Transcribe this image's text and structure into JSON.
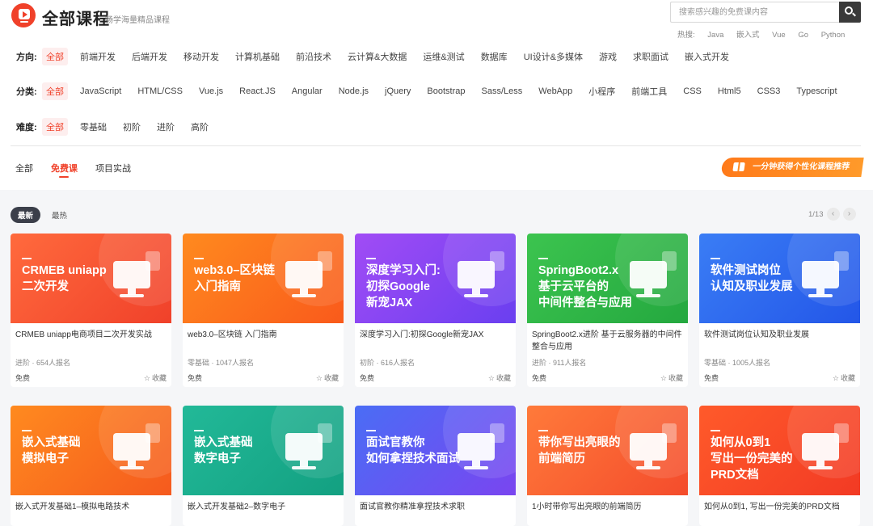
{
  "header": {
    "title": "全部课程",
    "subtitle": "畅学海量精品课程",
    "search_placeholder": "搜索感兴趣的免费课内容",
    "hot_label": "热搜:",
    "hot_words": [
      "Java",
      "嵌入式",
      "Vue",
      "Go",
      "Python"
    ]
  },
  "filters": {
    "direction": {
      "label": "方向:",
      "options": [
        "全部",
        "前端开发",
        "后端开发",
        "移动开发",
        "计算机基础",
        "前沿技术",
        "云计算&大数据",
        "运维&测试",
        "数据库",
        "UI设计&多媒体",
        "游戏",
        "求职面试",
        "嵌入式开发"
      ]
    },
    "category": {
      "label": "分类:",
      "options": [
        "全部",
        "JavaScript",
        "HTML/CSS",
        "Vue.js",
        "React.JS",
        "Angular",
        "Node.js",
        "jQuery",
        "Bootstrap",
        "Sass/Less",
        "WebApp",
        "小程序",
        "前端工具",
        "CSS",
        "Html5",
        "CSS3",
        "Typescript"
      ]
    },
    "difficulty": {
      "label": "难度:",
      "options": [
        "全部",
        "零基础",
        "初阶",
        "进阶",
        "高阶"
      ]
    }
  },
  "tabs": [
    "全部",
    "免费课",
    "项目实战"
  ],
  "promo_label": "一分钟获得个性化课程推荐",
  "sort": {
    "newest": "最新",
    "hottest": "最热"
  },
  "pager": {
    "text": "1/13",
    "prev": "‹",
    "next": "›"
  },
  "fav_label": "收藏",
  "colors": {
    "accent": "#f0412a",
    "orange_red": "#f4512c",
    "orange": "#f77a1c",
    "purple": "#8a3ff0",
    "green": "#2fb84b",
    "blue": "#2e6af0",
    "teal": "#17b08f"
  },
  "courses": [
    {
      "thumb_text": "CRMEB uniapp\n二次开发",
      "title": "CRMEB uniapp电商项目二次开发实战",
      "meta": "进阶 · 654人报名",
      "price": "免费",
      "icon": "puzzle-monitor-icon"
    },
    {
      "thumb_text": "web3.0–区块链\n入门指南",
      "title": "web3.0–区块链 入门指南",
      "meta": "零基础 · 1047人报名",
      "price": "免费",
      "icon": "blockchain-cubes-icon"
    },
    {
      "thumb_text": "深度学习入门:\n初探Google\n新宠JAX",
      "title": "深度学习入门:初探Google新宠JAX",
      "meta": "初阶 · 616人报名",
      "price": "免费",
      "icon": "jax-monitor-icon"
    },
    {
      "thumb_text": "SpringBoot2.x\n基于云平台的\n中间件整合与应用",
      "title": "SpringBoot2.x进阶 基于云服务器的中间件整合与应用",
      "meta": "进阶 · 911人报名",
      "price": "免费",
      "icon": "power-hexagon-icon"
    },
    {
      "thumb_text": "软件测试岗位\n认知及职业发展",
      "title": "软件测试岗位认知及职业发展",
      "meta": "零基础 · 1005人报名",
      "price": "免费",
      "icon": "gauge-monitor-icon"
    },
    {
      "thumb_text": "嵌入式基础\n模拟电子",
      "title": "嵌入式开发基础1–模拟电路技术",
      "icon": "server-chip-icon"
    },
    {
      "thumb_text": "嵌入式基础\n数字电子",
      "title": "嵌入式开发基础2–数字电子",
      "icon": "server-stack-icon"
    },
    {
      "thumb_text": "面试官教你\n如何拿捏技术面试",
      "title": "面试官教你精准拿捏技术求职",
      "icon": "id-card-icon"
    },
    {
      "thumb_text": "带你写出亮眼的\n前端简历",
      "title": "1小时带你写出亮眼的前端简历",
      "icon": "html5-resume-icon"
    },
    {
      "thumb_text": "如何从0到1\n写出一份完美的\nPRD文档",
      "title": "如何从0到1, 写出一份完美的PRD文档",
      "icon": "pdf-document-icon"
    }
  ]
}
